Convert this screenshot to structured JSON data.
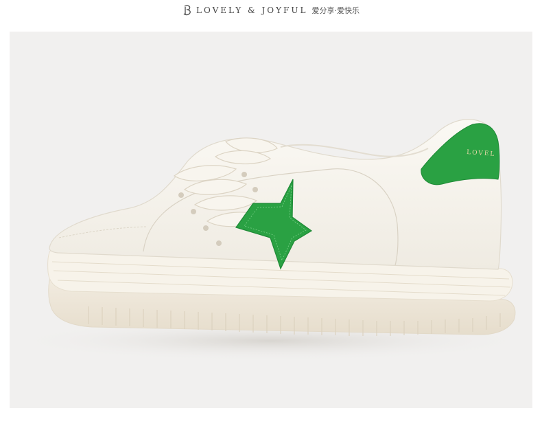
{
  "header": {
    "logo_icon": "stylized-b-logo-icon",
    "brand_text": "LOVELY & JOYFUL",
    "brand_cn": "爱分享·爱快乐"
  },
  "product": {
    "heel_text": "LOVEL",
    "colors": {
      "background": "#f1f0ef",
      "leather": "#f6f3ec",
      "accent_green": "#2aa143",
      "sole": "#efe8db"
    }
  }
}
